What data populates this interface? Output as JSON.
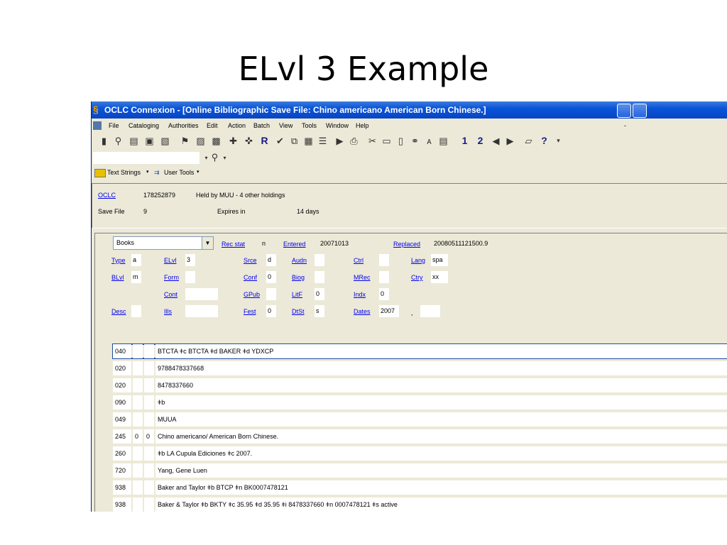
{
  "slide": {
    "title": "ELvl 3 Example"
  },
  "window": {
    "title": "OCLC Connexion - [Online Bibliographic Save File: Chino americano American Born Chinese.]"
  },
  "menu": [
    "File",
    "Cataloging",
    "Authorities",
    "Edit",
    "Action",
    "Batch",
    "View",
    "Tools",
    "Window",
    "Help"
  ],
  "toolbar": {
    "btn_r": "R",
    "btn_1": "1",
    "btn_2": "2",
    "btn_q": "?"
  },
  "toolbar2": {
    "text_strings": "Text Strings",
    "user_tools": "User Tools"
  },
  "header": {
    "oclc_label": "OCLC",
    "oclc_number": "178252879",
    "held_by": "Held by MUU - 4 other holdings",
    "save_file_label": "Save File",
    "save_file_number": "9",
    "expires_label": "Expires in",
    "expires_value": "14 days"
  },
  "fixed": {
    "format": "Books",
    "rec_stat": {
      "label": "Rec stat",
      "value": "n"
    },
    "entered": {
      "label": "Entered",
      "value": "20071013"
    },
    "replaced": {
      "label": "Replaced",
      "value": "20080511121500.9"
    },
    "type": {
      "label": "Type",
      "value": "a"
    },
    "elvl": {
      "label": "ELvl",
      "value": "3"
    },
    "srce": {
      "label": "Srce",
      "value": "d"
    },
    "audn": {
      "label": "Audn",
      "value": ""
    },
    "ctrl": {
      "label": "Ctrl",
      "value": ""
    },
    "lang": {
      "label": "Lang",
      "value": "spa"
    },
    "blvl": {
      "label": "BLvl",
      "value": "m"
    },
    "form": {
      "label": "Form",
      "value": ""
    },
    "conf": {
      "label": "Conf",
      "value": "0"
    },
    "biog": {
      "label": "Biog",
      "value": ""
    },
    "mrec": {
      "label": "MRec",
      "value": ""
    },
    "ctry": {
      "label": "Ctry",
      "value": "xx"
    },
    "cont": {
      "label": "Cont",
      "value": ""
    },
    "gpub": {
      "label": "GPub",
      "value": ""
    },
    "litf": {
      "label": "LitF",
      "value": "0"
    },
    "indx": {
      "label": "Indx",
      "value": "0"
    },
    "desc": {
      "label": "Desc",
      "value": ""
    },
    "ills": {
      "label": "Ills",
      "value": ""
    },
    "fest": {
      "label": "Fest",
      "value": "0"
    },
    "dtst": {
      "label": "DtSt",
      "value": "s"
    },
    "dates": {
      "label": "Dates",
      "value": "2007",
      "sep": ","
    }
  },
  "variable_fields": [
    {
      "tag": "040",
      "i1": "",
      "i2": "",
      "content": "BTCTA ǂc BTCTA ǂd BAKER ǂd YDXCP"
    },
    {
      "tag": "020",
      "i1": "",
      "i2": "",
      "content": "9788478337668"
    },
    {
      "tag": "020",
      "i1": "",
      "i2": "",
      "content": "8478337660"
    },
    {
      "tag": "090",
      "i1": "",
      "i2": "",
      "content": "ǂb"
    },
    {
      "tag": "049",
      "i1": "",
      "i2": "",
      "content": "MUUA"
    },
    {
      "tag": "245",
      "i1": "0",
      "i2": "0",
      "content": "Chino americano/ American Born Chinese."
    },
    {
      "tag": "260",
      "i1": "",
      "i2": "",
      "content": "ǂb LA Cupula Ediciones ǂc 2007."
    },
    {
      "tag": "720",
      "i1": "",
      "i2": "",
      "content": "Yang, Gene Luen"
    },
    {
      "tag": "938",
      "i1": "",
      "i2": "",
      "content": "Baker and Taylor ǂb BTCP ǂn BK0007478121"
    },
    {
      "tag": "938",
      "i1": "",
      "i2": "",
      "content": "Baker & Taylor ǂb BKTY ǂc 35.95 ǂd 35.95 ǂi 8478337660 ǂn 0007478121 ǂs active"
    }
  ]
}
